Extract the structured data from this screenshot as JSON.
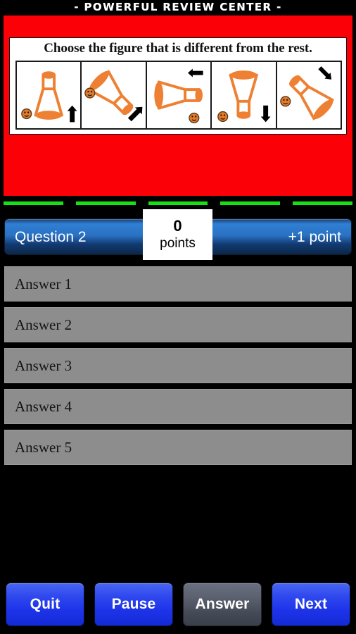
{
  "app": {
    "title": "- POWERFUL REVIEW CENTER -"
  },
  "question_card": {
    "background_color": "#fb0007",
    "prompt": "Choose the figure that is different from the rest.",
    "figures": [
      {
        "name": "figure-1",
        "rotation_deg": 0,
        "arrow": "up",
        "smiley": "bottom-left"
      },
      {
        "name": "figure-2",
        "rotation_deg": 135,
        "arrow": "up-right",
        "smiley": "left"
      },
      {
        "name": "figure-3",
        "rotation_deg": 90,
        "arrow": "left",
        "smiley": "bottom-right"
      },
      {
        "name": "figure-4",
        "rotation_deg": 180,
        "arrow": "down",
        "smiley": "bottom-left"
      },
      {
        "name": "figure-5",
        "rotation_deg": 315,
        "arrow": "down-right",
        "smiley": "left"
      }
    ],
    "figure_color": "#ee8033"
  },
  "progress": {
    "total_segments": 5,
    "filled_segments": 5,
    "fill_color": "#16e016"
  },
  "status": {
    "question_label": "Question 2",
    "point_value_label": "+1 point",
    "score_value": "0",
    "score_label": "points"
  },
  "answers": [
    {
      "label": "Answer 1"
    },
    {
      "label": "Answer 2"
    },
    {
      "label": "Answer 3"
    },
    {
      "label": "Answer 4"
    },
    {
      "label": "Answer 5"
    }
  ],
  "buttons": [
    {
      "label": "Quit",
      "style": "primary"
    },
    {
      "label": "Pause",
      "style": "primary"
    },
    {
      "label": "Answer",
      "style": "muted"
    },
    {
      "label": "Next",
      "style": "primary"
    }
  ]
}
